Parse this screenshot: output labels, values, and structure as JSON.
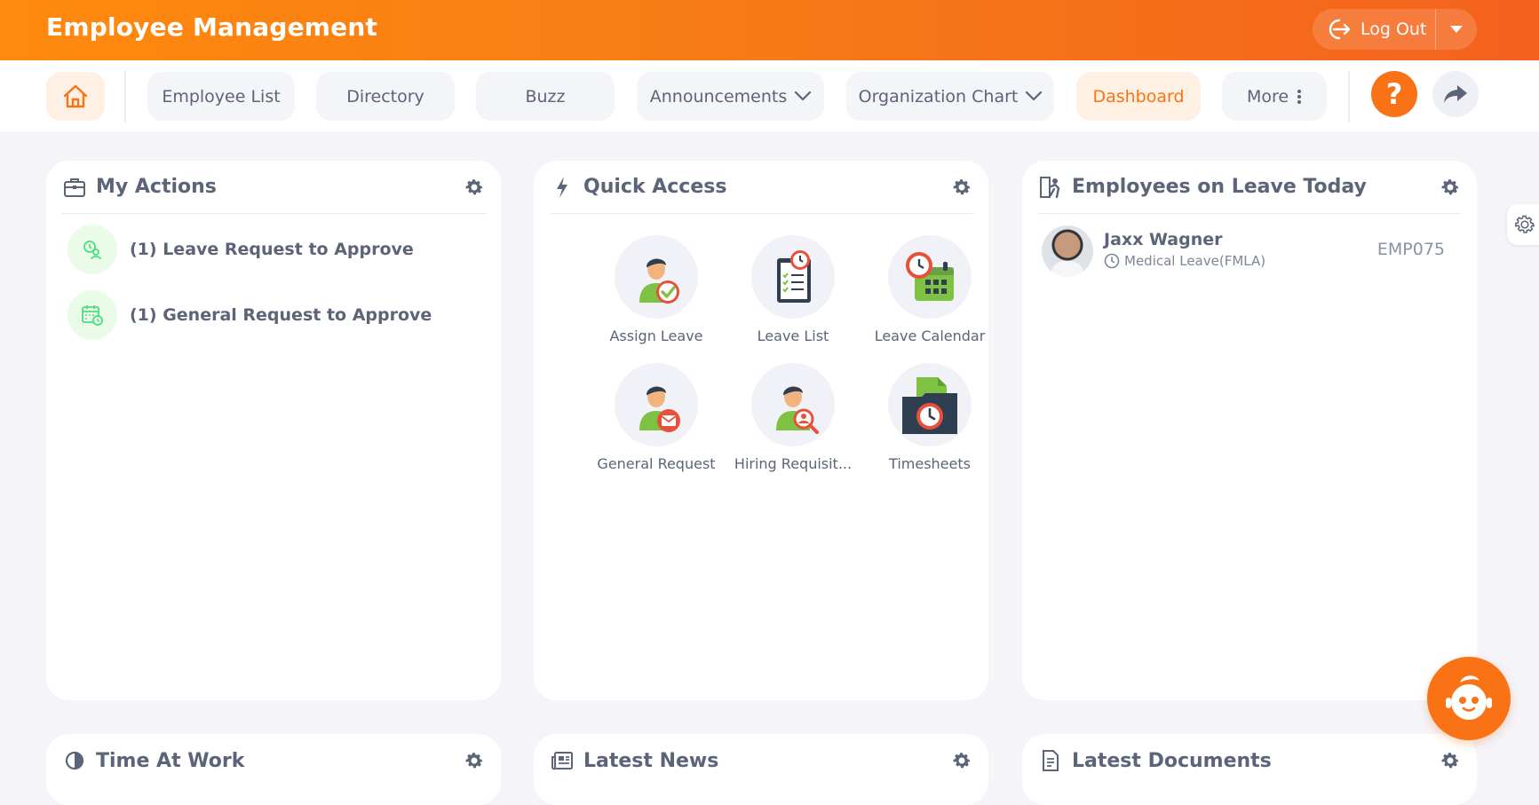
{
  "header": {
    "title": "Employee Management",
    "logout_label": "Log Out"
  },
  "nav": {
    "items": [
      {
        "label": "Employee List"
      },
      {
        "label": "Directory"
      },
      {
        "label": "Buzz"
      },
      {
        "label": "Announcements"
      },
      {
        "label": "Organization Chart"
      },
      {
        "label": "Dashboard"
      },
      {
        "label": "More"
      }
    ],
    "help_label": "?",
    "active": "Dashboard"
  },
  "widgets": {
    "my_actions": {
      "title": "My Actions",
      "items": [
        {
          "label": "(1) Leave Request to Approve"
        },
        {
          "label": "(1) General Request to Approve"
        }
      ]
    },
    "quick_access": {
      "title": "Quick Access",
      "items": [
        {
          "label": "Assign Leave",
          "icon": "assign-leave-icon"
        },
        {
          "label": "Leave List",
          "icon": "leave-list-icon"
        },
        {
          "label": "Leave Calendar",
          "icon": "leave-calendar-icon"
        },
        {
          "label": "General Request",
          "icon": "general-request-icon"
        },
        {
          "label": "Hiring Requisit...",
          "icon": "hiring-requisition-icon"
        },
        {
          "label": "Timesheets",
          "icon": "timesheets-icon"
        }
      ]
    },
    "on_leave": {
      "title": "Employees on Leave Today",
      "employees": [
        {
          "name": "Jaxx Wagner",
          "leave_type": "Medical Leave(FMLA)",
          "id": "EMP075"
        }
      ]
    },
    "time_at_work": {
      "title": "Time At Work"
    },
    "latest_news": {
      "title": "Latest News"
    },
    "latest_documents": {
      "title": "Latest Documents"
    }
  },
  "colors": {
    "brand_orange": "#f97316",
    "header_gradient_start": "#ff8a0f",
    "header_gradient_end": "#f4621e",
    "text": "#5b6478",
    "page_bg": "#f4f4f9"
  }
}
